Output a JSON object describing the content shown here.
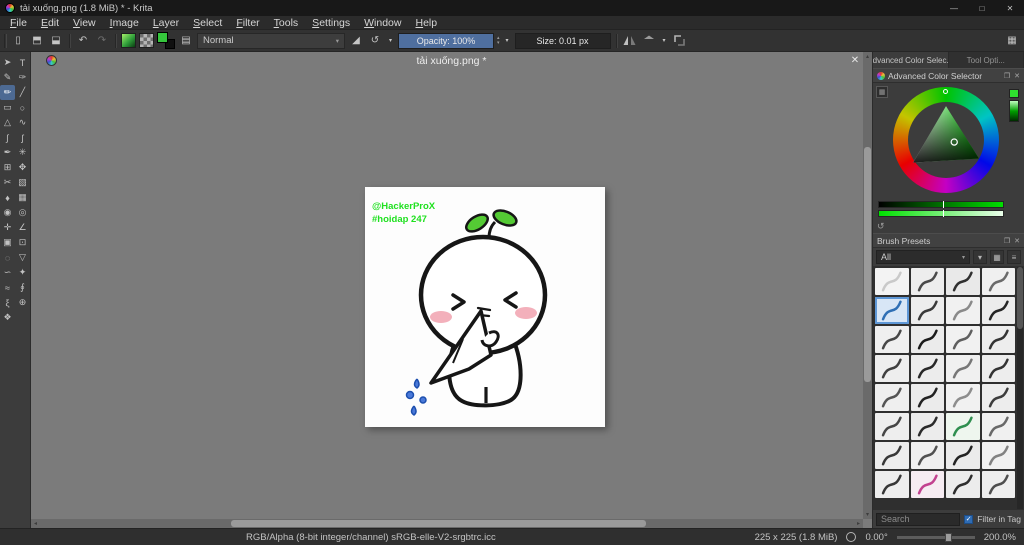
{
  "titlebar": {
    "title": "tải xuống.png (1.8 MiB) * - Krita"
  },
  "menu": {
    "items": [
      "File",
      "Edit",
      "View",
      "Image",
      "Layer",
      "Select",
      "Filter",
      "Tools",
      "Settings",
      "Window",
      "Help"
    ]
  },
  "toolbar": {
    "blend_mode": "Normal",
    "opacity": "Opacity: 100%",
    "size": "Size: 0.01 px"
  },
  "toolbox": {
    "active_index": 4,
    "tools": [
      {
        "name": "select-shapes",
        "glyph": "➤"
      },
      {
        "name": "text",
        "glyph": "T"
      },
      {
        "name": "edit-shapes",
        "glyph": "✎"
      },
      {
        "name": "calligraphy",
        "glyph": "✑"
      },
      {
        "name": "freehand-brush",
        "glyph": "✏"
      },
      {
        "name": "line",
        "glyph": "╱"
      },
      {
        "name": "rectangle",
        "glyph": "▭"
      },
      {
        "name": "ellipse",
        "glyph": "○"
      },
      {
        "name": "polygon",
        "glyph": "△"
      },
      {
        "name": "polyline",
        "glyph": "∿"
      },
      {
        "name": "bezier-curve",
        "glyph": "∫"
      },
      {
        "name": "freehand-path",
        "glyph": "ʃ"
      },
      {
        "name": "dynamic-brush",
        "glyph": "✒"
      },
      {
        "name": "multibrush",
        "glyph": "✳"
      },
      {
        "name": "transform",
        "glyph": "⊞"
      },
      {
        "name": "move",
        "glyph": "✥"
      },
      {
        "name": "crop",
        "glyph": "✂"
      },
      {
        "name": "gradient",
        "glyph": "▧"
      },
      {
        "name": "color-sampler",
        "glyph": "♦"
      },
      {
        "name": "pattern-edit",
        "glyph": "▦"
      },
      {
        "name": "fill",
        "glyph": "◉"
      },
      {
        "name": "enclose-fill",
        "glyph": "◎"
      },
      {
        "name": "assistants",
        "glyph": "✛"
      },
      {
        "name": "measure",
        "glyph": "∠"
      },
      {
        "name": "reference-images",
        "glyph": "▣"
      },
      {
        "name": "rectangular-selection",
        "glyph": "⊡"
      },
      {
        "name": "elliptical-selection",
        "glyph": "◌"
      },
      {
        "name": "polygonal-selection",
        "glyph": "▽"
      },
      {
        "name": "freehand-selection",
        "glyph": "∽"
      },
      {
        "name": "contiguous-selection",
        "glyph": "✦"
      },
      {
        "name": "similar-color-selection",
        "glyph": "≈"
      },
      {
        "name": "bezier-selection",
        "glyph": "∮"
      },
      {
        "name": "magnetic-selection",
        "glyph": "ξ"
      },
      {
        "name": "zoom",
        "glyph": "⊕"
      },
      {
        "name": "pan",
        "glyph": "❖"
      }
    ]
  },
  "document": {
    "tab": "tải xuống.png *"
  },
  "canvas": {
    "watermark_line1": "@HackerProX",
    "watermark_line2": "#hoidap 247"
  },
  "right_panel": {
    "tabs": [
      "Advanced Color Selec...",
      "Tool Opti..."
    ],
    "advanced_color_selector": {
      "title": "Advanced Color Selector"
    },
    "brush_presets": {
      "title": "Brush Presets",
      "tag_filter": "All",
      "search_placeholder": "Search",
      "filter_in_tag": "Filter in Tag",
      "selected_index": 4,
      "cells": [
        {
          "bg": "#f3f3f3",
          "stroke": "#c9c9c9"
        },
        {
          "bg": "#ededed",
          "stroke": "#4a4a4a"
        },
        {
          "bg": "#e9e9e9",
          "stroke": "#303030"
        },
        {
          "bg": "#f0f0f0",
          "stroke": "#6a6a6a"
        },
        {
          "bg": "#d8e6f6",
          "stroke": "#2f6fb5"
        },
        {
          "bg": "#ededed",
          "stroke": "#3a3a3a"
        },
        {
          "bg": "#f1f1f1",
          "stroke": "#8a8a8a"
        },
        {
          "bg": "#ececec",
          "stroke": "#252525"
        },
        {
          "bg": "#efefef",
          "stroke": "#474747"
        },
        {
          "bg": "#ebebeb",
          "stroke": "#1c1c1c"
        },
        {
          "bg": "#f1f1f1",
          "stroke": "#5f5f5f"
        },
        {
          "bg": "#ededed",
          "stroke": "#343434"
        },
        {
          "bg": "#eeeeee",
          "stroke": "#404040"
        },
        {
          "bg": "#ececec",
          "stroke": "#282828"
        },
        {
          "bg": "#f0f0f0",
          "stroke": "#777777"
        },
        {
          "bg": "#ededed",
          "stroke": "#333333"
        },
        {
          "bg": "#efefef",
          "stroke": "#555555"
        },
        {
          "bg": "#ebebeb",
          "stroke": "#222222"
        },
        {
          "bg": "#f1f1f1",
          "stroke": "#8d8d8d"
        },
        {
          "bg": "#ededed",
          "stroke": "#3d3d3d"
        },
        {
          "bg": "#eeeeee",
          "stroke": "#464646"
        },
        {
          "bg": "#ececec",
          "stroke": "#2b2b2b"
        },
        {
          "bg": "#eef6ee",
          "stroke": "#2f8f4f"
        },
        {
          "bg": "#f0f0f0",
          "stroke": "#696969"
        },
        {
          "bg": "#ededed",
          "stroke": "#383838"
        },
        {
          "bg": "#efefef",
          "stroke": "#515151"
        },
        {
          "bg": "#ebebeb",
          "stroke": "#242424"
        },
        {
          "bg": "#f1f1f1",
          "stroke": "#828282"
        },
        {
          "bg": "#ededed",
          "stroke": "#363636"
        },
        {
          "bg": "#f6ecf2",
          "stroke": "#c2418f"
        },
        {
          "bg": "#ececec",
          "stroke": "#2e2e2e"
        },
        {
          "bg": "#eeeeee",
          "stroke": "#4e4e4e"
        }
      ]
    }
  },
  "statusbar": {
    "profile": "RGB/Alpha (8-bit integer/channel)  sRGB-elle-V2-srgbtrc.icc",
    "dimensions": "225 x 225 (1.8 MiB)",
    "angle": "0.00°",
    "zoom": "200.0%"
  },
  "icons": {
    "minimize": "—",
    "maximize": "□",
    "close": "✕",
    "undo": "↶",
    "redo": "↷",
    "refresh": "↺",
    "dropdown": "▾",
    "up": "▴",
    "down": "▾",
    "left": "◂",
    "right": "▸",
    "float": "❐",
    "grid": "▦",
    "list": "≡",
    "check": "✓",
    "tag": "▾",
    "history": "▦",
    "workspace": "▦",
    "eraser": "◢",
    "brush_chooser": "▤"
  },
  "colors": {
    "accent_blue": "#4f6f9f",
    "selection_blue": "#5e97d6",
    "watermark_green": "#1fe11f"
  }
}
